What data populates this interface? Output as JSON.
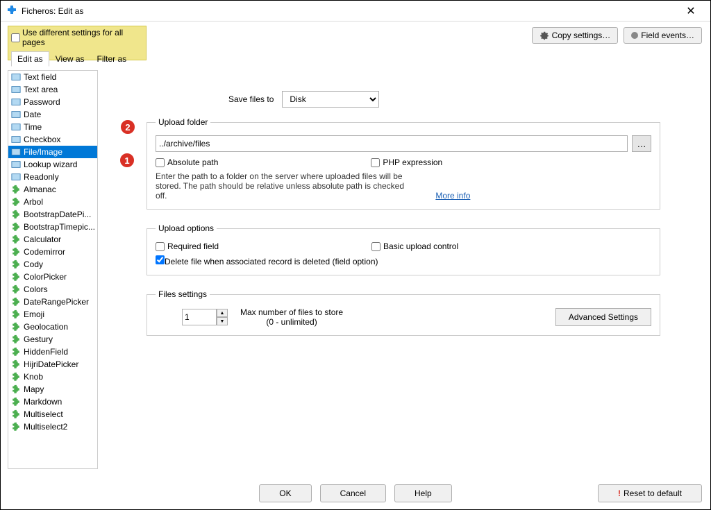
{
  "window": {
    "title": "Ficheros: Edit as"
  },
  "toolbar": {
    "use_different": "Use different settings for all pages",
    "tabs": [
      "Edit as",
      "View as",
      "Filter as"
    ],
    "copy_settings": "Copy settings…",
    "field_events": "Field events…"
  },
  "sidebar": [
    {
      "label": "Text field",
      "icon": "textfield"
    },
    {
      "label": "Text area",
      "icon": "textarea"
    },
    {
      "label": "Password",
      "icon": "password"
    },
    {
      "label": "Date",
      "icon": "date"
    },
    {
      "label": "Time",
      "icon": "time"
    },
    {
      "label": "Checkbox",
      "icon": "checkbox"
    },
    {
      "label": "File/Image",
      "icon": "file",
      "selected": true
    },
    {
      "label": "Lookup wizard",
      "icon": "lookup"
    },
    {
      "label": "Readonly",
      "icon": "readonly"
    },
    {
      "label": "Almanac",
      "icon": "plugin"
    },
    {
      "label": "Arbol",
      "icon": "plugin"
    },
    {
      "label": "BootstrapDatePi...",
      "icon": "plugin"
    },
    {
      "label": "BootstrapTimepic...",
      "icon": "plugin"
    },
    {
      "label": "Calculator",
      "icon": "plugin"
    },
    {
      "label": "Codemirror",
      "icon": "plugin"
    },
    {
      "label": "Cody",
      "icon": "plugin"
    },
    {
      "label": "ColorPicker",
      "icon": "plugin"
    },
    {
      "label": "Colors",
      "icon": "plugin"
    },
    {
      "label": "DateRangePicker",
      "icon": "plugin"
    },
    {
      "label": "Emoji",
      "icon": "plugin"
    },
    {
      "label": "Geolocation",
      "icon": "plugin"
    },
    {
      "label": "Gestury",
      "icon": "plugin"
    },
    {
      "label": "HiddenField",
      "icon": "plugin"
    },
    {
      "label": "HijriDatePicker",
      "icon": "plugin"
    },
    {
      "label": "Knob",
      "icon": "plugin"
    },
    {
      "label": "Mapy",
      "icon": "plugin"
    },
    {
      "label": "Markdown",
      "icon": "plugin"
    },
    {
      "label": "Multiselect",
      "icon": "plugin"
    },
    {
      "label": "Multiselect2",
      "icon": "plugin"
    }
  ],
  "form": {
    "save_files_label": "Save files to",
    "save_files_value": "Disk",
    "upload_folder_legend": "Upload folder",
    "upload_folder_value": "../archive/files",
    "absolute_path": "Absolute path",
    "php_expression": "PHP expression",
    "path_desc": "Enter the path to a folder on the server where uploaded files will be stored. The path should be relative unless absolute path is checked off.",
    "more_info": "More info",
    "upload_options_legend": "Upload options",
    "required_field": "Required field",
    "basic_upload": "Basic upload control",
    "delete_file": "Delete file when associated record is deleted (field option)",
    "files_settings_legend": "Files settings",
    "max_files_value": "1",
    "max_files_label": "Max number of files to store",
    "max_files_sub": "(0 - unlimited)",
    "advanced": "Advanced Settings"
  },
  "footer": {
    "ok": "OK",
    "cancel": "Cancel",
    "help": "Help",
    "reset": "Reset to default"
  },
  "annotations": {
    "one": "1",
    "two": "2"
  }
}
